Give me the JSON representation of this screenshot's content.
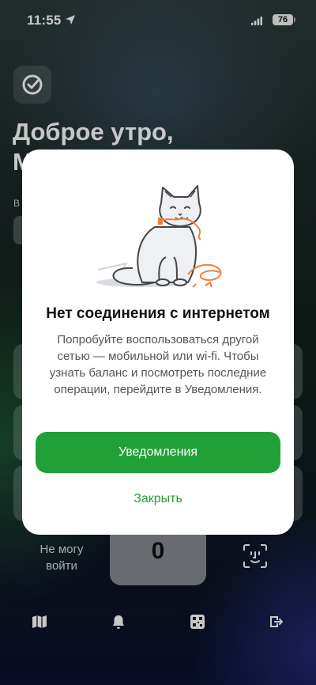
{
  "status_bar": {
    "time": "11:55",
    "battery": "76"
  },
  "background": {
    "greeting_line1": "Доброе утро,",
    "greeting_line2": "М",
    "label_fragment": "В",
    "pad_left_label": "Не могу войти",
    "pad_digit": "0"
  },
  "dialog": {
    "title": "Нет соединения с интернетом",
    "message": "Попробуйте воспользоваться другой сетью — мобильной или wi-fi. Чтобы узнать баланс и посмотреть последние операции, перейдите в Уведомления.",
    "primary_button": "Уведомления",
    "close_button": "Закрыть"
  },
  "tab_bar": {
    "icons": [
      "map-icon",
      "bell-icon",
      "qr-code-icon",
      "logout-icon"
    ]
  },
  "colors": {
    "accent": "#21a038",
    "cat_cable": "#f07f3c"
  }
}
